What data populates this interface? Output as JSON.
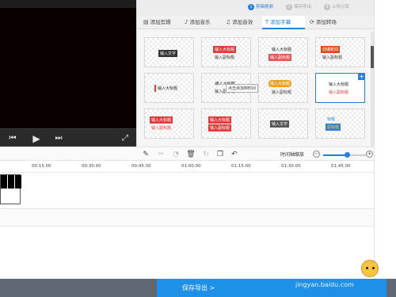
{
  "steps": [
    {
      "num": "1",
      "label": "剪辑视频",
      "active": true
    },
    {
      "num": "2",
      "label": "保存导出",
      "active": false
    },
    {
      "num": "3",
      "label": "上传分享",
      "active": false
    }
  ],
  "tabs": [
    {
      "icon": "clip-icon",
      "glyph": "▤",
      "label": "添加剪辑",
      "active": false
    },
    {
      "icon": "music-icon",
      "glyph": "♪",
      "label": "添加音乐",
      "active": false
    },
    {
      "icon": "audio-icon",
      "glyph": "♫",
      "label": "添加音效",
      "active": false
    },
    {
      "icon": "text-icon",
      "glyph": "T",
      "label": "添加字幕",
      "active": true
    },
    {
      "icon": "transition-icon",
      "glyph": "⟳",
      "label": "添加转场",
      "active": false
    }
  ],
  "templates": [
    {
      "line1": "输入文字",
      "line2": ""
    },
    {
      "line1": "输入大标题",
      "line2": "输入副标题"
    },
    {
      "line1": "输入大标题",
      "line2": "输入副标题"
    },
    {
      "line1": "劲爆新闻",
      "line2": "输入副标题"
    },
    {
      "line1": "输入大标题",
      "line2": ""
    },
    {
      "line1": "输入大标题",
      "line2": "输入副标题"
    },
    {
      "line1": "输入大标题",
      "line2": "输入副标题"
    },
    {
      "line1": "输入大标题",
      "line2": "输入副标题"
    },
    {
      "line1": "输入大标题",
      "line2": "输入副标题"
    },
    {
      "line1": "输入大标题",
      "line2": "输入副标题"
    },
    {
      "line1": "输入文字",
      "line2": ""
    },
    {
      "line1": "标题",
      "line2": "副标题"
    }
  ],
  "tooltip": "点击添加到时间",
  "toolbar": {
    "zoom_label": "时间轴缩放",
    "zoom_level": 0.55
  },
  "timeline": {
    "ticks": [
      "00:15.00",
      "00:30.00",
      "00:45.00",
      "01:00.00",
      "01:15.00",
      "01:30.00",
      "01:45.00"
    ]
  },
  "bottom": {
    "export_label": "保存导出 >",
    "watermark": "jingyan.baidu.com"
  },
  "colors": {
    "accent": "#2b7dd6",
    "export": "#1e90e8",
    "bottom_bar": "#5f6875"
  }
}
